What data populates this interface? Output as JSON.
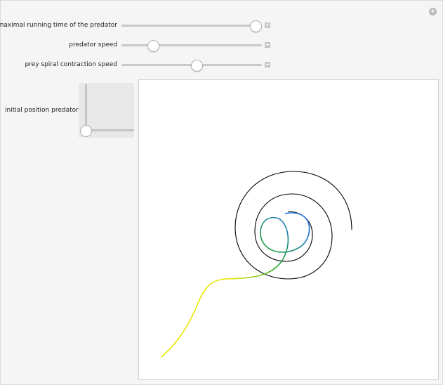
{
  "controls": {
    "sliders": [
      {
        "label": "maximal running time of the predator",
        "value": 0.95
      },
      {
        "label": "predator speed",
        "value": 0.22
      },
      {
        "label": "prey spiral contraction speed",
        "value": 0.53
      }
    ],
    "pad": {
      "label": "initial position predator"
    }
  },
  "icons": {
    "expand": "plus-icon",
    "options": "plus-circle-icon"
  },
  "colors": {
    "prey_spiral": "#000000",
    "predator_path_start": "#e6e600",
    "predator_path_mid": "#22aa22",
    "predator_path_end": "#1a6fd6"
  }
}
